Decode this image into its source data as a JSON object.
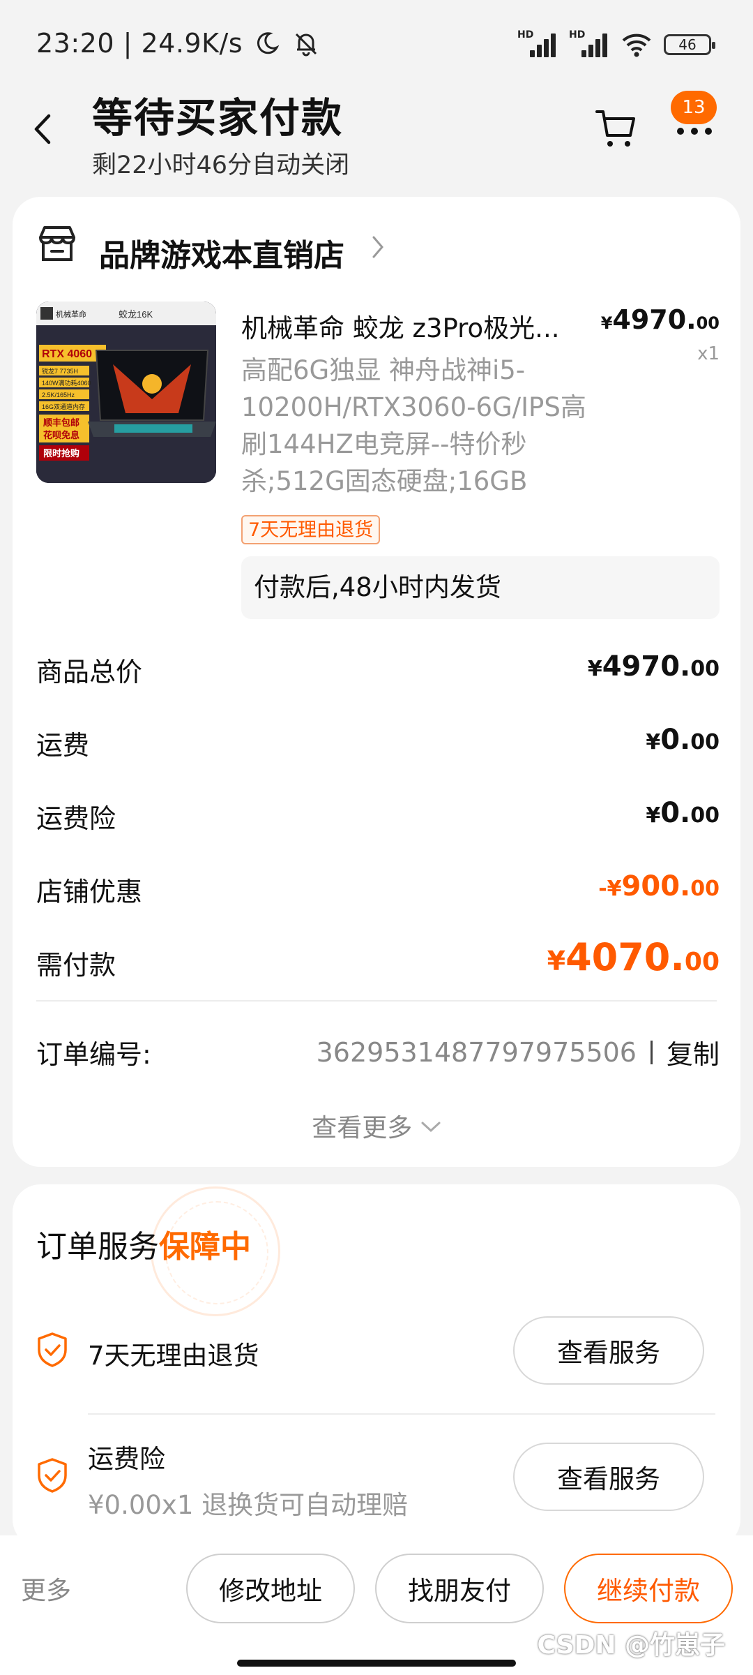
{
  "status_bar": {
    "time": "23:20 | 24.9K/s",
    "hd1": "HD",
    "hd2": "HD",
    "battery": "46"
  },
  "header": {
    "title": "等待买家付款",
    "subtitle": "剩22小时46分自动关闭",
    "badge_count": "13"
  },
  "store": {
    "name": "品牌游戏本直销店"
  },
  "product": {
    "title": "机械革命 蛟龙 z3Pro极光...",
    "price_symbol": "¥",
    "price_int": "4970.",
    "price_dec": "00",
    "quantity": "x1",
    "description": "高配6G独显 神舟战神i5-10200H/RTX3060-6G/IPS高刷144HZ电竞屏--特价秒杀;512G固态硬盘;16GB",
    "tag": "7天无理由退货",
    "shipping_note": "付款后,48小时内发货",
    "thumb": {
      "brand": "机械革命",
      "model": "蛟龙16K",
      "gpu": "RTX 4060",
      "specs": [
        "锐龙7 7735H",
        "140W满功耗4060",
        "2.5K/165Hz",
        "16G双通道内存"
      ],
      "promo": [
        "顺丰包邮",
        "花呗免息",
        "限时抢购"
      ]
    }
  },
  "summary": [
    {
      "label": "商品总价",
      "sym": "¥",
      "int": "4970.",
      "dec": "00"
    },
    {
      "label": "运费",
      "sym": "¥",
      "int": "0.",
      "dec": "00"
    },
    {
      "label": "运费险",
      "sym": "¥",
      "int": "0.",
      "dec": "00"
    },
    {
      "label": "店铺优惠",
      "sym": "-¥",
      "int": "900.",
      "dec": "00"
    },
    {
      "label": "需付款",
      "sym": "¥",
      "int": "4070.",
      "dec": "00"
    }
  ],
  "order": {
    "label": "订单编号:",
    "number": "3629531487797975506",
    "copy": "复制",
    "more": "查看更多"
  },
  "service": {
    "title": "订单服务",
    "title_highlight": "保障中",
    "items": [
      {
        "label": "7天无理由退货",
        "button": "查看服务"
      },
      {
        "label": "运费险",
        "sub": "¥0.00x1 退换货可自动理赔",
        "button": "查看服务"
      }
    ]
  },
  "bottom_bar": {
    "more": "更多",
    "buttons": [
      "修改地址",
      "找朋友付",
      "继续付款"
    ],
    "watermark": "CSDN @竹崽子"
  },
  "colors": {
    "accent": "#ff6a00",
    "background": "#f3f3f3"
  }
}
